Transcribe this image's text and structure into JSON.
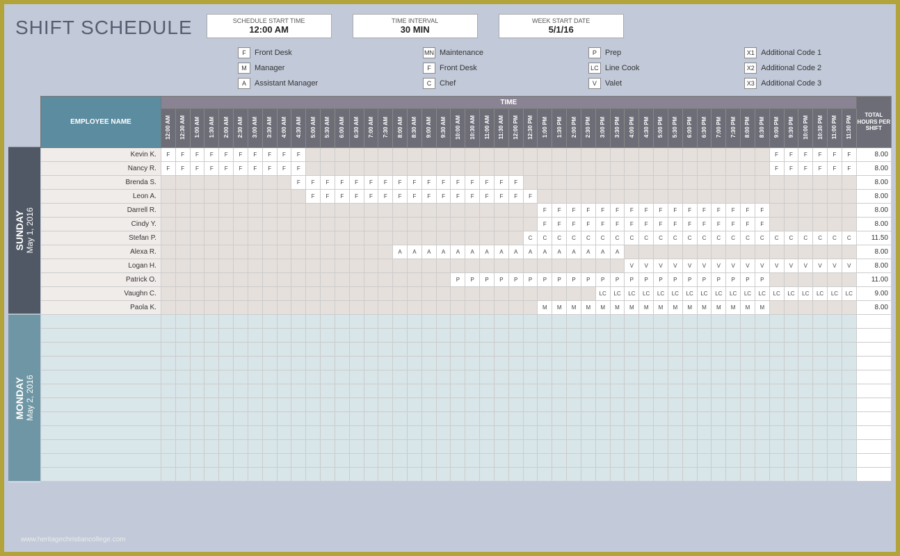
{
  "title": "SHIFT SCHEDULE",
  "info": {
    "start_time_label": "SCHEDULE START TIME",
    "start_time_value": "12:00 AM",
    "interval_label": "TIME INTERVAL",
    "interval_value": "30 MIN",
    "week_start_label": "WEEK START DATE",
    "week_start_value": "5/1/16"
  },
  "legend": [
    {
      "code": "F",
      "label": "Front Desk"
    },
    {
      "code": "MN",
      "label": "Maintenance"
    },
    {
      "code": "P",
      "label": "Prep"
    },
    {
      "code": "X1",
      "label": "Additional Code 1"
    },
    {
      "code": "M",
      "label": "Manager"
    },
    {
      "code": "F",
      "label": "Front Desk"
    },
    {
      "code": "LC",
      "label": "Line Cook"
    },
    {
      "code": "X2",
      "label": "Additional Code 2"
    },
    {
      "code": "A",
      "label": "Assistant Manager"
    },
    {
      "code": "C",
      "label": "Chef"
    },
    {
      "code": "V",
      "label": "Valet"
    },
    {
      "code": "X3",
      "label": "Additional Code 3"
    }
  ],
  "headers": {
    "employee_name": "EMPLOYEE NAME",
    "time_bar": "TIME",
    "total": "TOTAL HOURS PER SHIFT"
  },
  "time_slots": [
    "12:00 AM",
    "12:30 AM",
    "1:00 AM",
    "1:30 AM",
    "2:00 AM",
    "2:30 AM",
    "3:00 AM",
    "3:30 AM",
    "4:00 AM",
    "4:30 AM",
    "5:00 AM",
    "5:30 AM",
    "6:00 AM",
    "6:30 AM",
    "7:00 AM",
    "7:30 AM",
    "8:00 AM",
    "8:30 AM",
    "9:00 AM",
    "9:30 AM",
    "10:00 AM",
    "10:30 AM",
    "11:00 AM",
    "11:30 AM",
    "12:00 PM",
    "12:30 PM",
    "1:00 PM",
    "1:30 PM",
    "2:00 PM",
    "2:30 PM",
    "3:00 PM",
    "3:30 PM",
    "4:00 PM",
    "4:30 PM",
    "5:00 PM",
    "5:30 PM",
    "6:00 PM",
    "6:30 PM",
    "7:00 PM",
    "7:30 PM",
    "8:00 PM",
    "8:30 PM",
    "9:00 PM",
    "9:30 PM",
    "10:00 PM",
    "10:30 PM",
    "11:00 PM",
    "11:30 PM"
  ],
  "days": [
    {
      "dow": "SUNDAY",
      "date": "May 1, 2016",
      "alt": false,
      "rows": [
        {
          "name": "Kevin K.",
          "total": "8.00",
          "code": "F",
          "start": 0,
          "end": 9,
          "extra_start": 42,
          "extra_end": 47
        },
        {
          "name": "Nancy R.",
          "total": "8.00",
          "code": "F",
          "start": 0,
          "end": 9,
          "extra_start": 42,
          "extra_end": 47
        },
        {
          "name": "Brenda S.",
          "total": "8.00",
          "code": "F",
          "start": 9,
          "end": 24
        },
        {
          "name": "Leon A.",
          "total": "8.00",
          "code": "F",
          "start": 10,
          "end": 25
        },
        {
          "name": "Darrell R.",
          "total": "8.00",
          "code": "F",
          "start": 26,
          "end": 41
        },
        {
          "name": "Cindy Y.",
          "total": "8.00",
          "code": "F",
          "start": 26,
          "end": 41
        },
        {
          "name": "Stefan P.",
          "total": "11.50",
          "code": "C",
          "start": 25,
          "end": 47
        },
        {
          "name": "Alexa R.",
          "total": "8.00",
          "code": "A",
          "start": 16,
          "end": 31
        },
        {
          "name": "Logan H.",
          "total": "8.00",
          "code": "V",
          "start": 32,
          "end": 47
        },
        {
          "name": "Patrick O.",
          "total": "11.00",
          "code": "P",
          "start": 20,
          "end": 41
        },
        {
          "name": "Vaughn C.",
          "total": "9.00",
          "code": "LC",
          "start": 30,
          "end": 47
        },
        {
          "name": "Paola K.",
          "total": "8.00",
          "code": "M",
          "start": 26,
          "end": 41
        }
      ]
    },
    {
      "dow": "MONDAY",
      "date": "May 2, 2016",
      "alt": true,
      "rows": [
        {
          "name": "",
          "total": ""
        },
        {
          "name": "",
          "total": ""
        },
        {
          "name": "",
          "total": ""
        },
        {
          "name": "",
          "total": ""
        },
        {
          "name": "",
          "total": ""
        },
        {
          "name": "",
          "total": ""
        },
        {
          "name": "",
          "total": ""
        },
        {
          "name": "",
          "total": ""
        },
        {
          "name": "",
          "total": ""
        },
        {
          "name": "",
          "total": ""
        },
        {
          "name": "",
          "total": ""
        },
        {
          "name": "",
          "total": ""
        }
      ]
    }
  ],
  "watermark": "www.heritagechristiancollege.com"
}
